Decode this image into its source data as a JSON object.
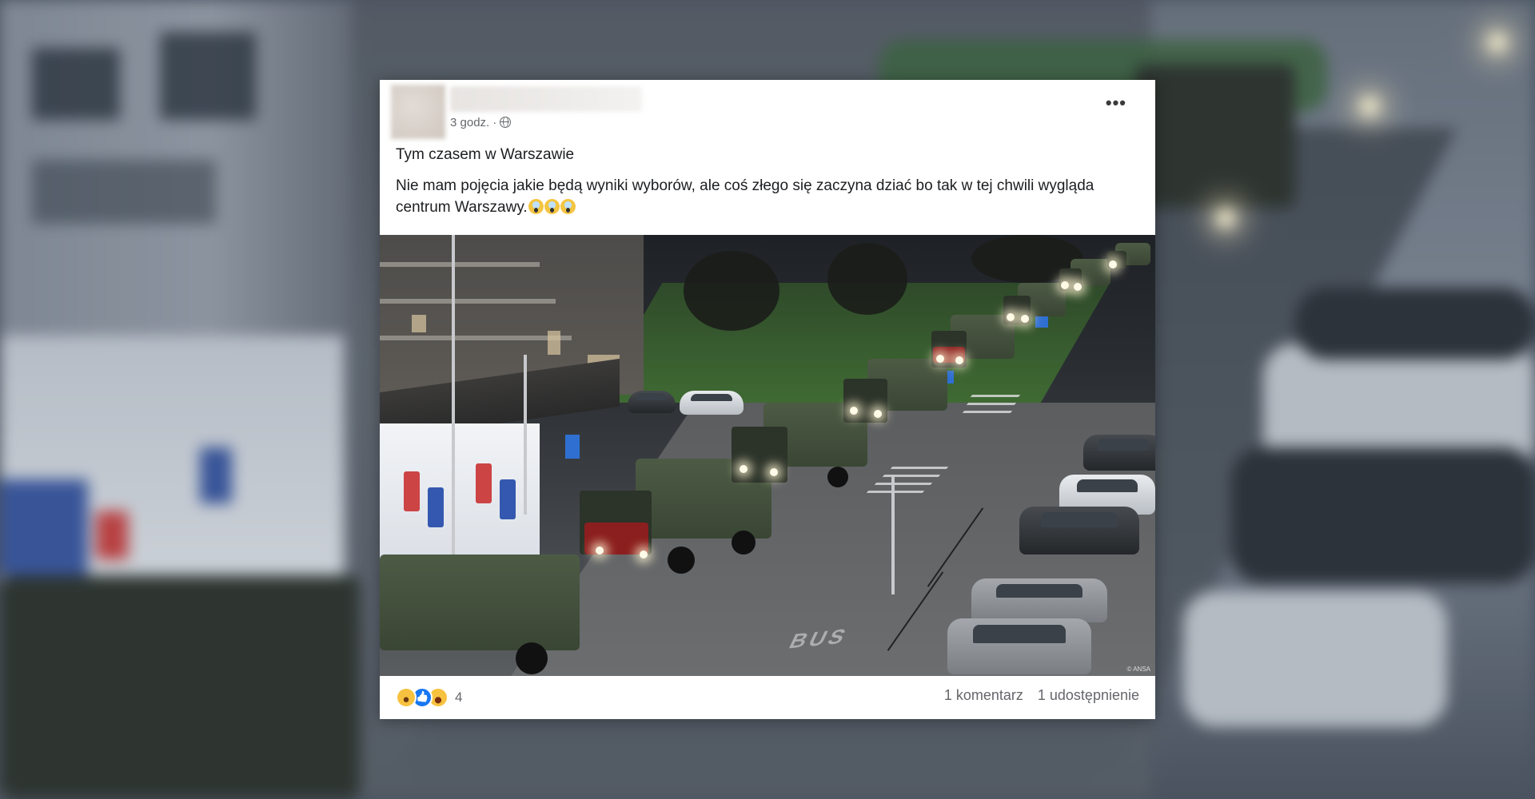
{
  "post": {
    "time": "3 godz.",
    "separator": "·",
    "privacy_icon": "globe-icon",
    "menu_icon": "more-options-icon",
    "menu_label": "•••",
    "text_line1": "Tym czasem w Warszawie",
    "text_line2": "Nie mam pojęcia jakie będą wyniki wyborów, ale coś złego się zaczyna dziać bo tak w tej chwili wygląda centrum Warszawy.",
    "text_emojis": [
      "scared-emoji",
      "scared-emoji",
      "scared-emoji"
    ]
  },
  "photo": {
    "road_marking": "BUS",
    "credit": "© ANSA"
  },
  "footer": {
    "reactions": [
      "wow-reaction-icon",
      "like-reaction-icon",
      "haha-reaction-icon"
    ],
    "reaction_count": "4",
    "comments": "1 komentarz",
    "shares": "1 udostępnienie"
  },
  "colors": {
    "facebook_blue": "#1877f2",
    "meta_text": "#65676b",
    "body_text": "#1c1e21"
  }
}
